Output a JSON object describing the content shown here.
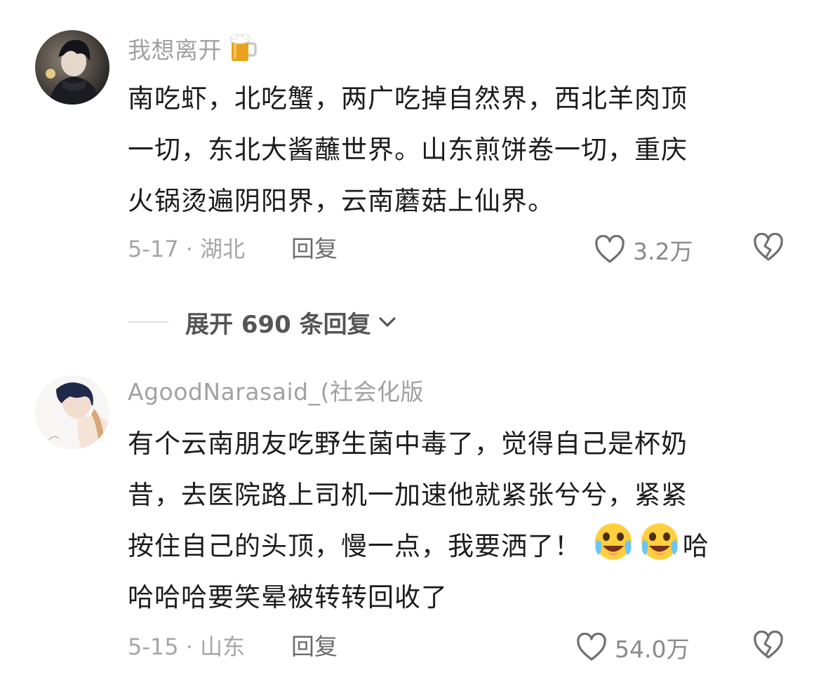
{
  "comments": [
    {
      "username": "我想离开",
      "username_emoji": "beer-mug",
      "lines": [
        "南吃虾，北吃蟹，两广吃掉自然界，西北羊肉顶",
        "一切，东北大酱蘸世界。山东煎饼卷一切，重庆",
        "火锅烫遍阴阳界，云南蘑菇上仙界。"
      ],
      "meta": "5-17 · 湖北",
      "reply_label": "回复",
      "like_count": "3.2万"
    },
    {
      "username": "AgoodNarasaid_(社会化版",
      "lines": [
        "有个云南朋友吃野生菌中毒了，觉得自己是杯奶",
        "昔，去医院路上司机一加速他就紧张兮兮，紧紧",
        "按住自己的头顶，慢一点，我要洒了！",
        "哈哈哈要笑晕被转转回收了"
      ],
      "line3_suffix": "哈",
      "meta": "5-15 · 山东",
      "reply_label": "回复",
      "like_count": "54.0万"
    }
  ],
  "expand_replies": {
    "label": "展开 690 条回复"
  },
  "colors": {
    "text": "#1c1c1c",
    "meta": "#a6a6a6",
    "username": "#a1a1a1"
  }
}
